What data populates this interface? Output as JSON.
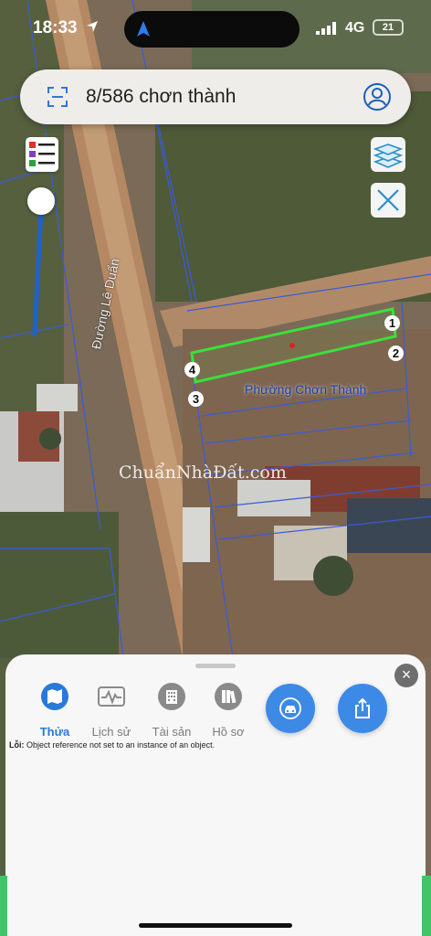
{
  "status_bar": {
    "time": "18:33",
    "network": "4G",
    "battery": "21"
  },
  "search": {
    "query": "8/586 chơn thành"
  },
  "map": {
    "road_label": "Đường Lê Duẩn",
    "ward_label": "Phường Chơn Thành",
    "watermark": "ChuẩnNhàĐất.com",
    "parcel_vertices": [
      "1",
      "2",
      "3",
      "4"
    ],
    "parcel_highlight_color": "#3be03b"
  },
  "sheet": {
    "tabs": [
      {
        "label": "Thửa",
        "icon": "map-icon",
        "active": true
      },
      {
        "label": "Lịch sử",
        "icon": "history-icon",
        "active": false
      },
      {
        "label": "Tài sản",
        "icon": "building-icon",
        "active": false
      },
      {
        "label": "Hồ sơ",
        "icon": "records-icon",
        "active": false
      }
    ],
    "actions": [
      {
        "icon": "car-icon"
      },
      {
        "icon": "share-icon"
      }
    ],
    "error_label": "Lỗi:",
    "error_message": "Object reference not set to an instance of an object."
  },
  "colors": {
    "accent": "#3d8ae6",
    "active_tab": "#2a79d9",
    "boundary": "#3a5bd6"
  }
}
